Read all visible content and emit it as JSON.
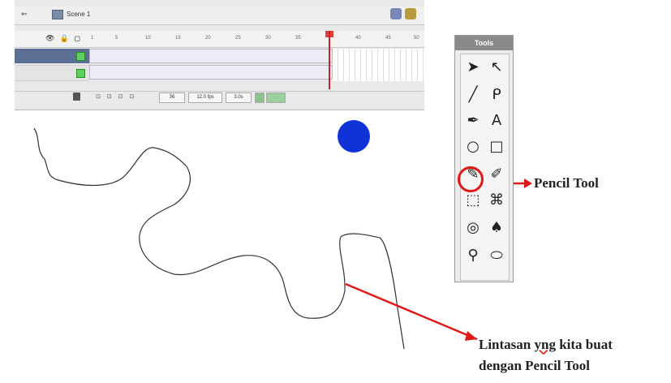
{
  "timeline": {
    "scene_label": "Scene 1",
    "fps_value": "12.0 fps",
    "time_value": "3.0s",
    "frame_number": "36",
    "ruler_ticks": [
      "1",
      "5",
      "10",
      "15",
      "20",
      "25",
      "30",
      "35",
      "40",
      "45",
      "50"
    ]
  },
  "tools_panel": {
    "title": "Tools",
    "tools": [
      {
        "name": "arrow-tool",
        "glyph": "➤"
      },
      {
        "name": "subselect-tool",
        "glyph": "↖"
      },
      {
        "name": "line-tool",
        "glyph": "╱"
      },
      {
        "name": "lasso-tool",
        "glyph": "ᑭ"
      },
      {
        "name": "pen-tool",
        "glyph": "✒"
      },
      {
        "name": "text-tool",
        "glyph": "A"
      },
      {
        "name": "oval-tool",
        "glyph": "○"
      },
      {
        "name": "rectangle-tool",
        "glyph": "□"
      },
      {
        "name": "pencil-tool",
        "glyph": "✎"
      },
      {
        "name": "brush-tool",
        "glyph": "✐"
      },
      {
        "name": "free-transform-tool",
        "glyph": "⬚"
      },
      {
        "name": "fill-transform-tool",
        "glyph": "⌘"
      },
      {
        "name": "ink-bottle-tool",
        "glyph": "◎"
      },
      {
        "name": "paint-bucket-tool",
        "glyph": "♠"
      },
      {
        "name": "eyedropper-tool",
        "glyph": "⚲"
      },
      {
        "name": "eraser-tool",
        "glyph": "⬭"
      }
    ]
  },
  "annotations": {
    "pencil_tool_label": "Pencil Tool",
    "path_caption_line1_a": "Lintasan ",
    "path_caption_line1_b": "yng",
    "path_caption_line1_c": " kita buat",
    "path_caption_line2": "dengan Pencil Tool"
  },
  "colors": {
    "circle_fill": "#1033d8",
    "annotation_red": "#e01818"
  }
}
